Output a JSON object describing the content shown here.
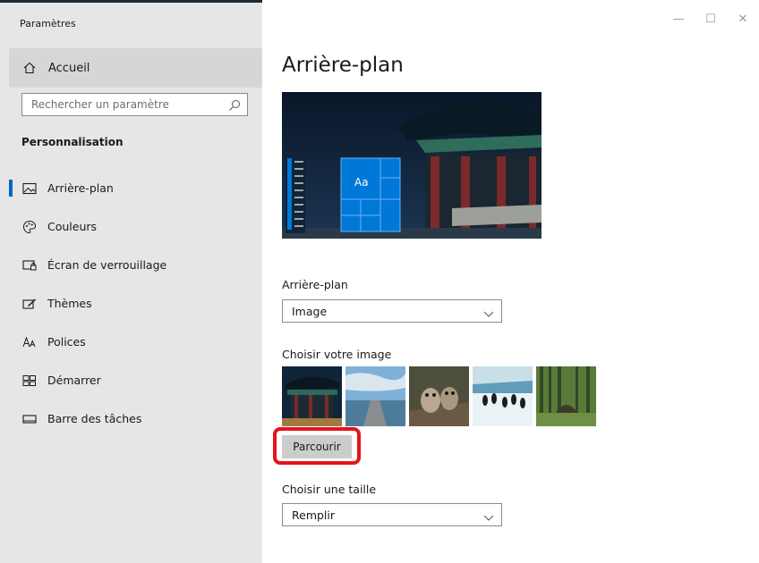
{
  "window": {
    "app_title": "Paramètres",
    "controls": {
      "minimize": "—",
      "maximize": "☐",
      "close": "✕"
    }
  },
  "sidebar": {
    "home_label": "Accueil",
    "search_placeholder": "Rechercher un paramètre",
    "section_title": "Personnalisation",
    "items": [
      {
        "label": "Arrière-plan",
        "icon": "picture-icon",
        "selected": true
      },
      {
        "label": "Couleurs",
        "icon": "palette-icon",
        "selected": false
      },
      {
        "label": "Écran de verrouillage",
        "icon": "lock-screen-icon",
        "selected": false
      },
      {
        "label": "Thèmes",
        "icon": "themes-icon",
        "selected": false
      },
      {
        "label": "Polices",
        "icon": "fonts-icon",
        "selected": false
      },
      {
        "label": "Démarrer",
        "icon": "start-icon",
        "selected": false
      },
      {
        "label": "Barre des tâches",
        "icon": "taskbar-icon",
        "selected": false
      }
    ]
  },
  "main": {
    "title": "Arrière-plan",
    "preview_tile_text": "Aa",
    "background_label": "Arrière-plan",
    "background_value": "Image",
    "choose_image_label": "Choisir votre image",
    "browse_label": "Parcourir",
    "choose_size_label": "Choisir une taille",
    "size_value": "Remplir"
  },
  "colors": {
    "accent": "#0067c0",
    "sidebar_bg": "#e6e6e6",
    "highlight_ring": "#e3141b"
  }
}
